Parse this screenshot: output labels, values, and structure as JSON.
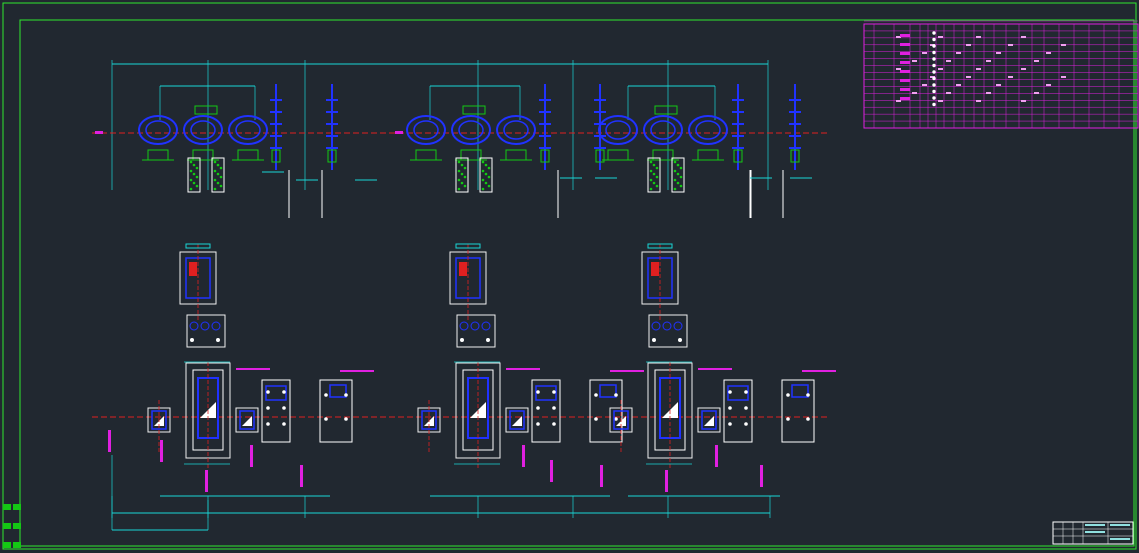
{
  "drawing": {
    "title_block": {
      "cells": [
        "",
        "",
        "",
        "",
        "",
        "",
        "",
        ""
      ]
    },
    "schedule_table": {
      "title": "",
      "columns": 14,
      "rows": 15
    },
    "units": {
      "elevation_pump_rows": 3,
      "plan_unit_groups": 3
    },
    "colors": {
      "background": "#212830",
      "frame": "#2ee82e",
      "equipment": "#2032ff",
      "dimension": "#19d6d6",
      "centerline": "#e02020",
      "annotation": "#e020e0",
      "outline": "#f0f0f0",
      "foundation": "#14c814"
    }
  },
  "toolbar": {
    "icons": [
      "layer-icon",
      "layer-icon",
      "layer-icon",
      "layer-icon",
      "layer-icon",
      "layer-icon"
    ]
  }
}
